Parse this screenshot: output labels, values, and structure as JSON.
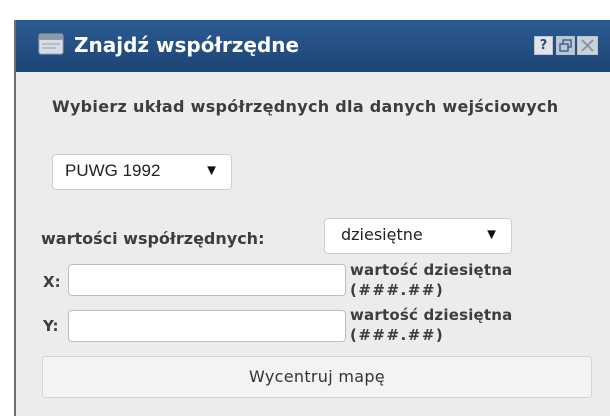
{
  "window": {
    "title": "Znajdź współrzędne",
    "title_icon": "window-icon",
    "buttons": {
      "help_label": "?",
      "restore_icon": "restore-icon",
      "close_icon": "close-icon"
    }
  },
  "form": {
    "heading": "Wybierz układ współrzędnych dla danych wejściowych",
    "coordinate_system": {
      "selected": "PUWG 1992",
      "arrow": "▼"
    },
    "values_label": "wartości współrzędnych:",
    "value_format": {
      "selected": "dziesiętne",
      "arrow": "▼"
    },
    "x": {
      "label": "X:",
      "value": "",
      "hint_line1": "wartość dziesiętna",
      "hint_line2": "(###.##)"
    },
    "y": {
      "label": "Y:",
      "value": "",
      "hint_line1": "wartość dziesiętna",
      "hint_line2": "(###.##)"
    },
    "center_button_label": "Wycentruj mapę"
  },
  "colors": {
    "titlebar": "#1d4576",
    "dialog_background": "#ececec"
  }
}
